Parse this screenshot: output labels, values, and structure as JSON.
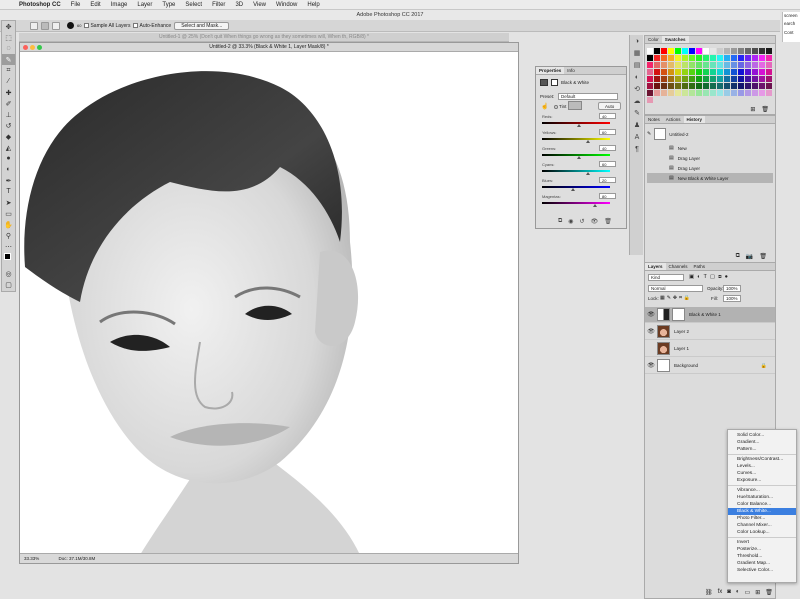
{
  "menubar": {
    "apple": "",
    "app": "Photoshop CC",
    "items": [
      "File",
      "Edit",
      "Image",
      "Layer",
      "Type",
      "Select",
      "Filter",
      "3D",
      "View",
      "Window",
      "Help"
    ]
  },
  "app_title": "Adobe Photoshop CC 2017",
  "options": {
    "brush_size": "60",
    "sample_all": "Sample All Layers",
    "auto_enhance": "Auto-Enhance",
    "select_mask": "Select and Mask..."
  },
  "tabs": {
    "inactive": "Untitled-1 @ 25% (Don't quit When things go wrong as they sometimes will, When th, RGB/8) *",
    "active": "Untitled-2 @ 33.3% (Black & White 1, Layer Mask/8) *"
  },
  "status": {
    "zoom": "33.33%",
    "doc": "Doc: 37.1M/30.8M"
  },
  "properties": {
    "tabs": [
      "Properties",
      "Info"
    ],
    "title": "Black & White",
    "preset_label": "Preset:",
    "preset": "Default",
    "tint": "Tint",
    "auto": "Auto",
    "sliders": [
      {
        "label": "Reds:",
        "value": "40",
        "pos": 0.55,
        "gradient": "linear-gradient(90deg,#000,#ff0000)"
      },
      {
        "label": "Yellows:",
        "value": "60",
        "pos": 0.68,
        "gradient": "linear-gradient(90deg,#000,#ffff00)"
      },
      {
        "label": "Greens:",
        "value": "40",
        "pos": 0.55,
        "gradient": "linear-gradient(90deg,#000,#00ff00)"
      },
      {
        "label": "Cyans:",
        "value": "60",
        "pos": 0.68,
        "gradient": "linear-gradient(90deg,#000,#00ffff)"
      },
      {
        "label": "Blues:",
        "value": "20",
        "pos": 0.46,
        "gradient": "linear-gradient(90deg,#000,#0000ff)"
      },
      {
        "label": "Magentas:",
        "value": "80",
        "pos": 0.78,
        "gradient": "linear-gradient(90deg,#000,#ff00ff)"
      }
    ]
  },
  "swatches": {
    "tabs": [
      "Color",
      "Swatches"
    ]
  },
  "history": {
    "tabs": [
      "Notes",
      "Actions",
      "History"
    ],
    "snapshot": "Untitled-2",
    "items": [
      "New",
      "Drag Layer",
      "Drag Layer",
      "New Black & White Layer"
    ]
  },
  "layers": {
    "tabs": [
      "Layers",
      "Channels",
      "Paths"
    ],
    "kind": "Kind",
    "blend": "Normal",
    "opacity_label": "Opacity:",
    "opacity": "100%",
    "lock": "Lock:",
    "fill_label": "Fill:",
    "fill": "100%",
    "rows": [
      "Black & White 1",
      "Layer 2",
      "Layer 1",
      "Background"
    ]
  },
  "adjustment_menu": {
    "groups": [
      [
        "Solid Color...",
        "Gradient...",
        "Pattern..."
      ],
      [
        "Brightness/Contrast...",
        "Levels...",
        "Curves...",
        "Exposure..."
      ],
      [
        "Vibrance...",
        "Hue/Saturation...",
        "Color Balance...",
        "Black & White...",
        "Photo Filter...",
        "Channel Mixer...",
        "Color Lookup..."
      ],
      [
        "Invert",
        "Posterize...",
        "Threshold...",
        "Gradient Map...",
        "Selective Color..."
      ]
    ],
    "selected": "Black & White..."
  },
  "right_clip": {
    "a": "screen",
    "b": "earch",
    "c": "Cont"
  }
}
